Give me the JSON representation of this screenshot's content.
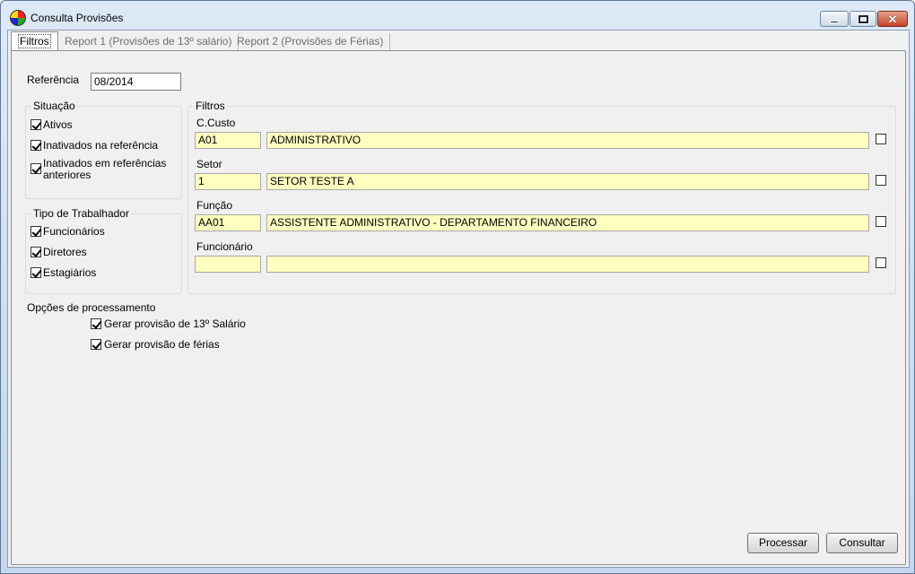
{
  "window": {
    "title": "Consulta Provisões",
    "accent": "#c4432b"
  },
  "tabs": [
    {
      "label": "Filtros"
    },
    {
      "label": "Report 1 (Provisões de 13º salário)"
    },
    {
      "label": "Report 2 (Provisões de Férias)"
    }
  ],
  "referencia": {
    "label": "Referência",
    "value": "08/2014"
  },
  "situacao": {
    "title": "Situação",
    "items": [
      {
        "label": "Ativos",
        "checked": true
      },
      {
        "label": "Inativados na referência",
        "checked": true
      },
      {
        "label": "Inativados em referências anteriores",
        "checked": true
      }
    ]
  },
  "tipo_trabalhador": {
    "title": "Tipo de Trabalhador",
    "items": [
      {
        "label": "Funcionários",
        "checked": true
      },
      {
        "label": "Diretores",
        "checked": true
      },
      {
        "label": "Estagiários",
        "checked": true
      }
    ]
  },
  "filtros": {
    "title": "Filtros",
    "fields": [
      {
        "label": "C.Custo",
        "code": "A01",
        "description": "ADMINISTRATIVO",
        "checked": false
      },
      {
        "label": "Setor",
        "code": "1",
        "description": "SETOR TESTE A",
        "checked": false
      },
      {
        "label": "Função",
        "code": "AA01",
        "description": "ASSISTENTE ADMINISTRATIVO - DEPARTAMENTO FINANCEIRO",
        "checked": false
      },
      {
        "label": "Funcionário",
        "code": "",
        "description": "",
        "checked": false
      }
    ]
  },
  "opcoes": {
    "title": "Opções de processamento",
    "items": [
      {
        "label": "Gerar provisão de 13º Salário",
        "checked": true
      },
      {
        "label": "Gerar provisão de férias",
        "checked": true
      }
    ]
  },
  "buttons": {
    "processar": "Processar",
    "consultar": "Consultar"
  }
}
